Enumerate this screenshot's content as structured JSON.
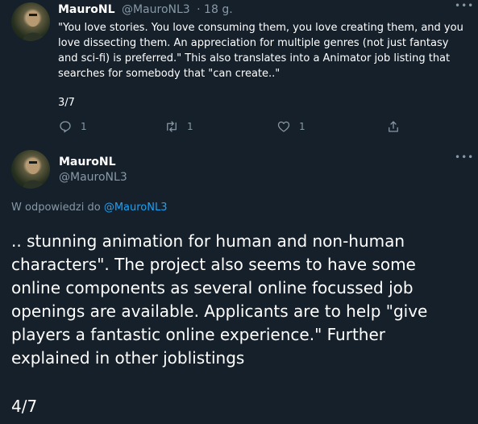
{
  "tweet1": {
    "author_name": "MauroNL",
    "handle": "@MauroNL3",
    "time": "· 18 g.",
    "text": "\"You love stories. You love consuming them, you love creating them, and you love dissecting them. An appreciation for multiple genres (not just fantasy and sci-fi) is preferred.\" This also translates into a Animator job listing that searches for somebody that \"can create..\"",
    "page": "3/7",
    "reply_count": "1",
    "retweet_count": "1",
    "like_count": "1",
    "icons": [
      "more-icon",
      "reply-icon",
      "retweet-icon",
      "like-icon",
      "share-icon"
    ]
  },
  "tweet2": {
    "author_name": "MauroNL",
    "handle": "@MauroNL3",
    "reply_prefix": "W odpowiedzi do ",
    "reply_handle": "@MauroNL3",
    "text": ".. stunning animation for human and non-human characters\". The project also seems to have some online components as several online focussed job openings are available. Applicants are to help \"give players a fantastic online experience.\" Further explained in other joblistings",
    "page": "4/7"
  },
  "colors": {
    "background": "#15202b",
    "text": "#ffffff",
    "muted": "#8899a6",
    "link": "#1da1f2"
  }
}
